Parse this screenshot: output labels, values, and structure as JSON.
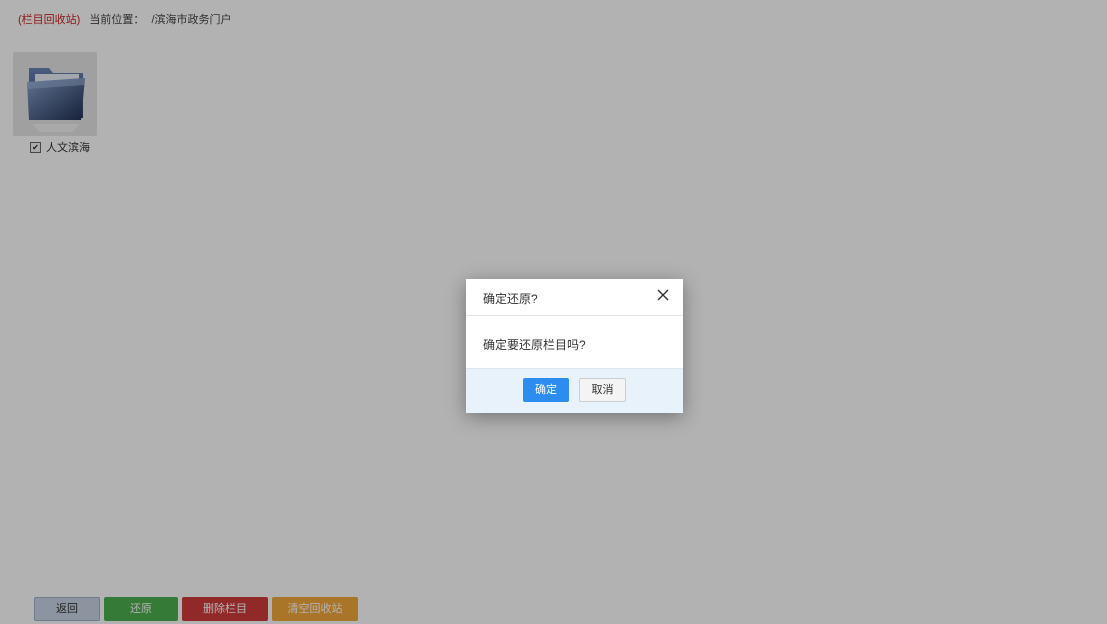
{
  "breadcrumb": {
    "tag": "(栏目回收站)",
    "label": "当前位置：",
    "path": "/滨海市政务门户"
  },
  "folder": {
    "icon": "folder-icon",
    "checked": true,
    "checkmark": "✔",
    "label": "人文滨海"
  },
  "bottom_bar": {
    "back": "返回",
    "restore": "还原",
    "delete": "删除栏目",
    "empty": "清空回收站"
  },
  "dialog": {
    "title": "确定还原?",
    "close_icon": "close-icon",
    "message": "确定要还原栏目吗?",
    "ok": "确定",
    "cancel": "取消"
  },
  "colors": {
    "accent": "#2d8cf0",
    "restore": "#4caf50",
    "delete": "#d13b3b",
    "empty": "#f2a93b",
    "tag": "#cc2222",
    "overlay": "rgba(0,0,0,0.30)"
  }
}
